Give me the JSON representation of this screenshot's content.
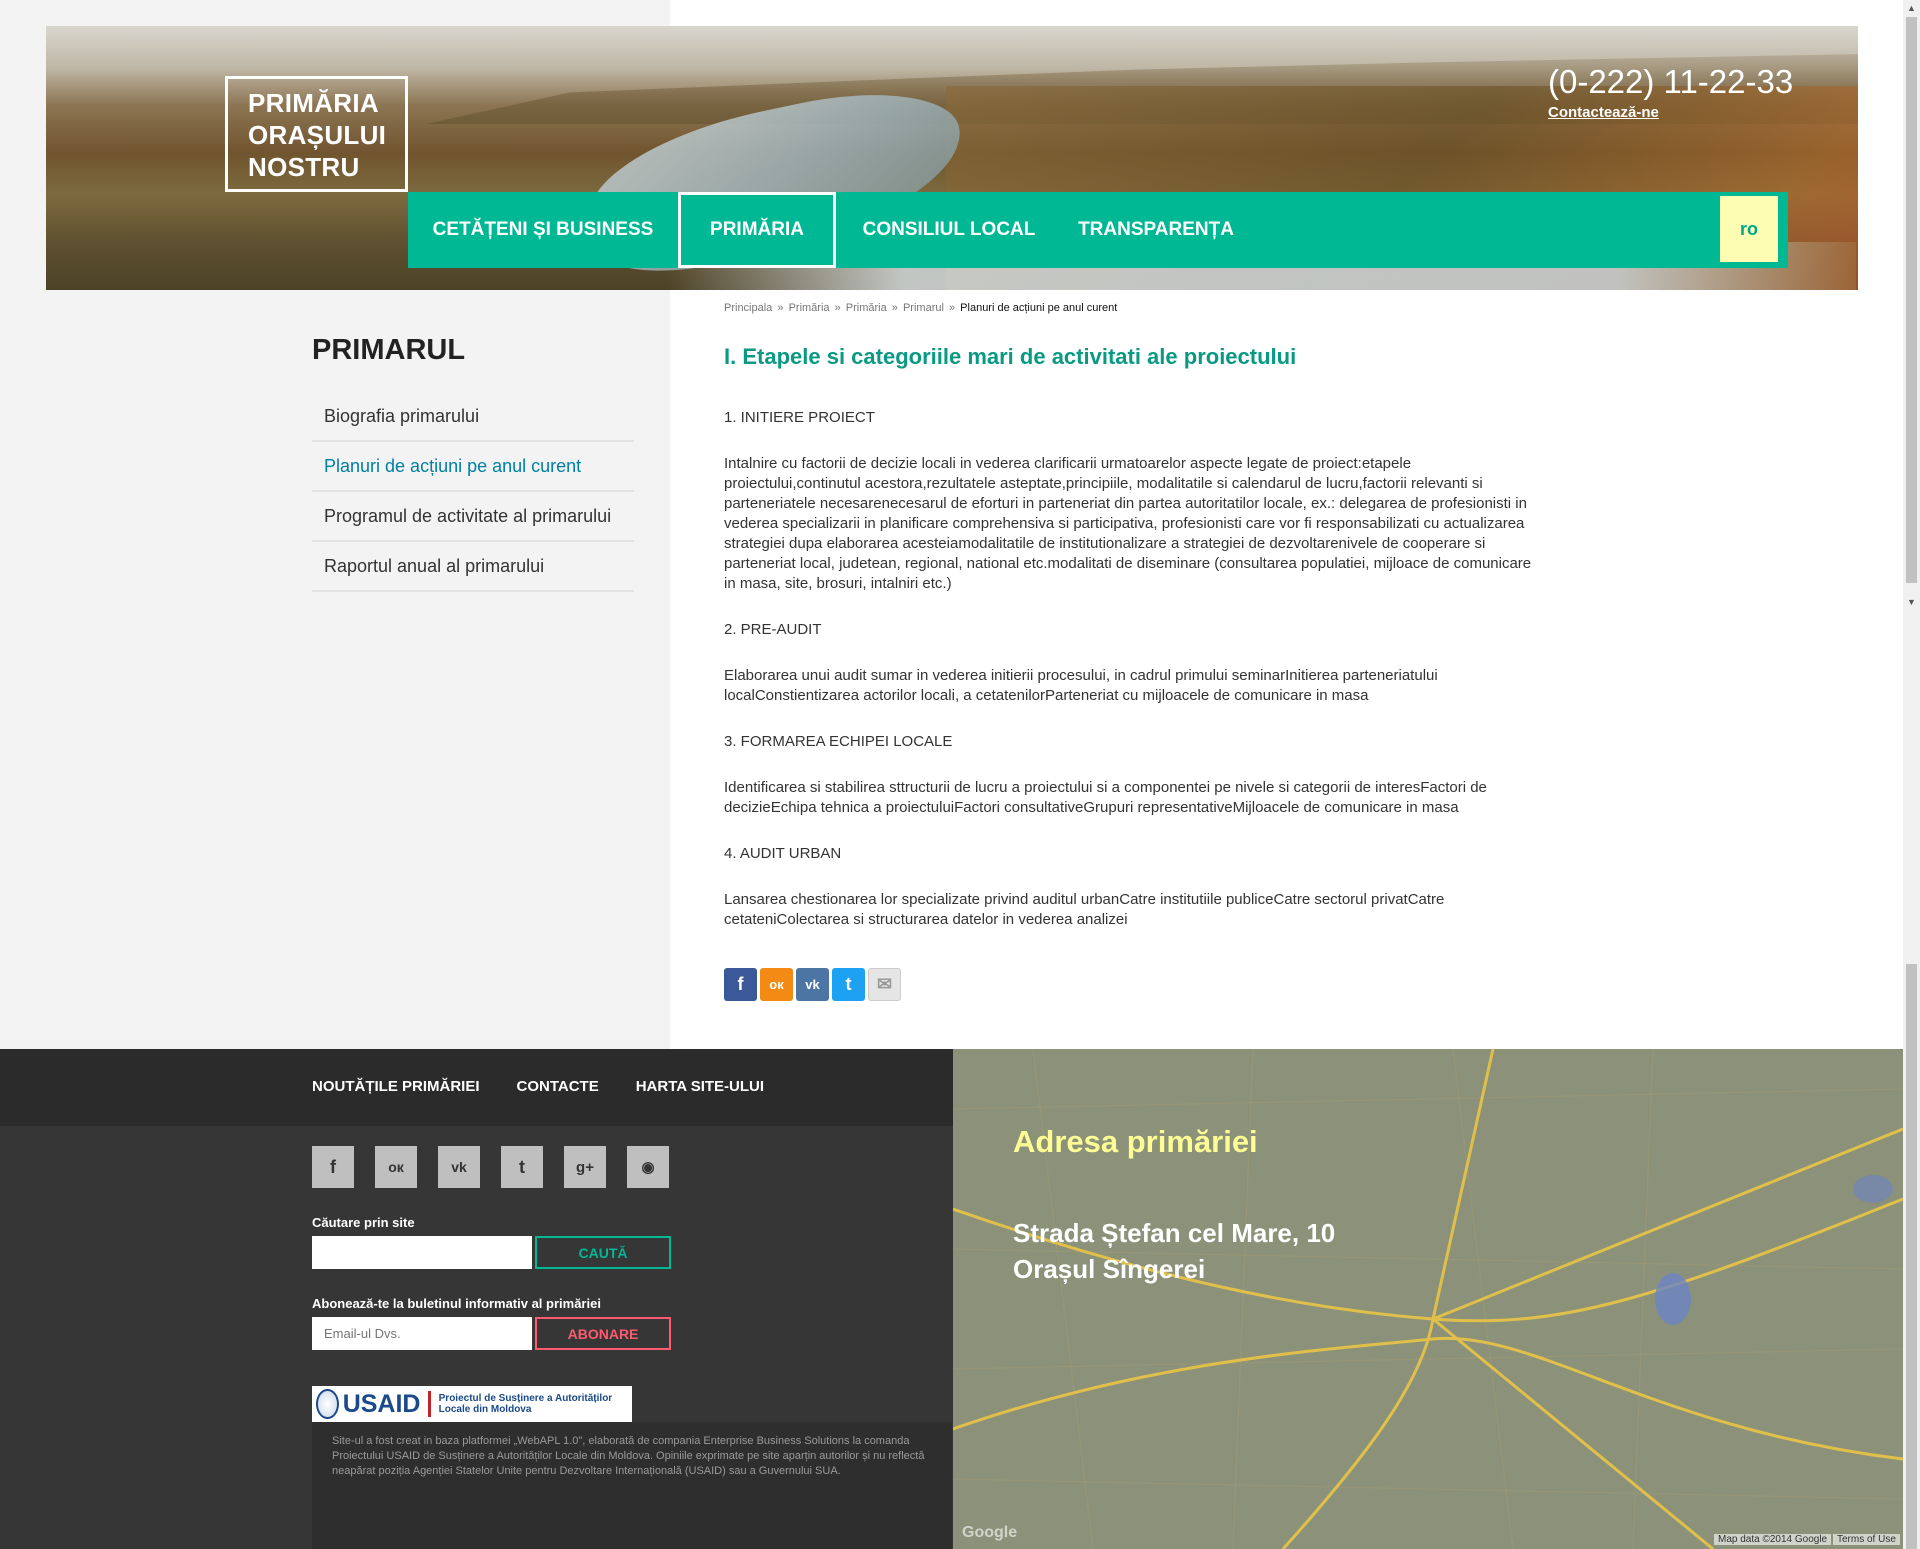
{
  "header": {
    "logo_lines": [
      "PRIMĂRIA",
      "ORAȘULUI",
      "NOSTRU"
    ],
    "phone": "(0-222) 11-22-33",
    "contact_link": "Contactează-ne",
    "nav": [
      {
        "label": "CETĂȚENI ȘI BUSINESS",
        "active": false
      },
      {
        "label": "PRIMĂRIA",
        "active": true
      },
      {
        "label": "CONSILIUL LOCAL",
        "active": false
      },
      {
        "label": "TRANSPARENȚA",
        "active": false
      }
    ],
    "lang": "ro",
    "accent_color": "#00b894"
  },
  "breadcrumb": {
    "items": [
      "Principala",
      "Primăria",
      "Primăria",
      "Primarul"
    ],
    "separator": "»",
    "current": "Planuri de acțiuni pe anul curent"
  },
  "sidebar": {
    "title": "PRIMARUL",
    "items": [
      {
        "label": "Biografia primarului",
        "active": false
      },
      {
        "label": "Planuri de acțiuni pe anul curent",
        "active": true
      },
      {
        "label": "Programul de activitate al primarului",
        "active": false
      },
      {
        "label": "Raportul anual al primarului",
        "active": false
      }
    ]
  },
  "content": {
    "title": "I. Etapele si categoriile mari de activitati ale proiectului",
    "sections": [
      {
        "heading": "1. INITIERE PROIECT",
        "text": "Intalnire cu factorii de decizie locali in vederea clarificarii urmatoarelor aspecte legate de proiect:etapele proiectului,continutul acestora,rezultatele asteptate,principiile, modalitatile si calendarul de lucru,factorii relevanti si parteneriatele necesarenecesarul de eforturi in parteneriat din partea autoritatilor locale, ex.: delegarea de profesionisti in vederea specializarii in planificare comprehensiva si participativa, profesionisti care vor fi responsabilizati cu actualizarea strategiei dupa elaborarea acesteiamodalitatile de institutionalizare a strategiei de dezvoltarenivele de cooperare si parteneriat local, judetean, regional, national etc.modalitati de diseminare (consultarea populatiei, mijloace de comunicare in masa, site, brosuri, intalniri etc.)"
      },
      {
        "heading": "2. PRE-AUDIT",
        "text": "Elaborarea unui audit sumar in vederea initierii procesului, in cadrul primului seminarInitierea parteneriatului localConstientizarea actorilor locali, a cetatenilorParteneriat cu mijloacele de comunicare in masa"
      },
      {
        "heading": "3. FORMAREA ECHIPEI LOCALE",
        "text": "Identificarea si stabilirea sttructurii de lucru a proiectului si a componentei pe nivele si categorii de interesFactori de decizieEchipa tehnica a proiectuluiFactori consultativeGrupuri representativeMijloacele de comunicare in masa"
      },
      {
        "heading": "4. AUDIT URBAN",
        "text": "Lansarea chestionarea lor specializate privind auditul urbanCatre institutiile publiceCatre sectorul privatCatre cetateniColectarea si structurarea datelor in vederea analizei"
      }
    ],
    "share": [
      {
        "icon": "facebook-icon",
        "glyph": "f",
        "color": "#3b5998"
      },
      {
        "icon": "odnoklassniki-icon",
        "glyph": "ок",
        "color": "#f28a13"
      },
      {
        "icon": "vk-icon",
        "glyph": "vk",
        "color": "#4c75a3"
      },
      {
        "icon": "twitter-icon",
        "glyph": "t",
        "color": "#1da1f2"
      },
      {
        "icon": "email-icon",
        "glyph": "✉",
        "color": "#e5e5e5"
      }
    ]
  },
  "footer": {
    "links": [
      "NOUTĂȚILE PRIMĂRIEI",
      "CONTACTE",
      "HARTA SITE-ULUI"
    ],
    "social": [
      {
        "icon": "facebook-icon",
        "glyph": "f"
      },
      {
        "icon": "odnoklassniki-icon",
        "glyph": "ок"
      },
      {
        "icon": "vk-icon",
        "glyph": "vk"
      },
      {
        "icon": "twitter-icon",
        "glyph": "t"
      },
      {
        "icon": "google-plus-icon",
        "glyph": "g+"
      },
      {
        "icon": "rss-icon",
        "glyph": "◉"
      }
    ],
    "search_label": "Căutare prin site",
    "search_value": "",
    "search_button": "CAUTĂ",
    "search_button_color": "#00b894",
    "subscribe_label": "Abonează-te la buletinul informativ al primăriei",
    "subscribe_placeholder": "Email-ul Dvs.",
    "subscribe_button": "ABONARE",
    "subscribe_button_color": "#ff5a6e",
    "usaid": {
      "name": "USAID",
      "project": "Proiectul de Susținere a Autorităților Locale din Moldova"
    },
    "disclaimer": "Site-ul a fost creat in baza platformei „WebAPL 1.0\", elaborată de compania Enterprise Business Solutions la comanda Proiectului USAID de Susținere a Autorităților Locale din Moldova. Opiniile exprimate pe site aparțin autorilor și nu reflectă neapărat poziția Agenției Statelor Unite pentru Dezvoltare Internațională (USAID) sau a Guvernului SUA."
  },
  "map": {
    "title": "Adresa primăriei",
    "address_line1": "Strada Ștefan cel Mare, 10",
    "address_line2": "Orașul Sîngerei",
    "map_data": "Map data ©2014 Google",
    "terms": "Terms of Use",
    "google": "Google"
  }
}
